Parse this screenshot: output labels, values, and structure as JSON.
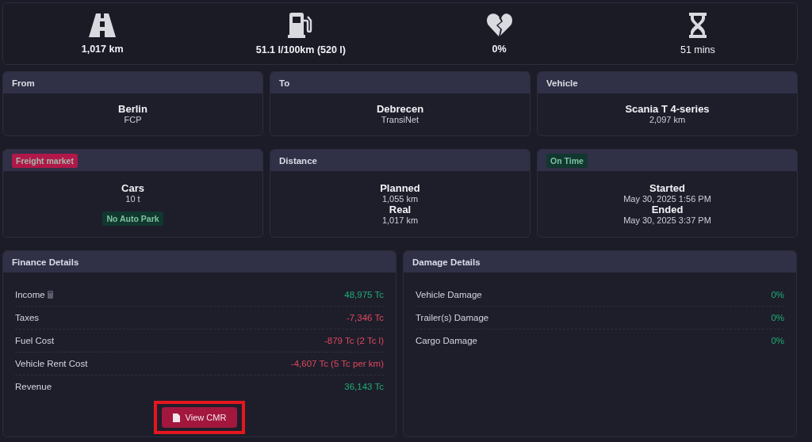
{
  "stats": [
    {
      "kind": "road",
      "value": "1,017 km",
      "emphasis": true
    },
    {
      "kind": "fuel",
      "value": "51.1 l/100km (520 l)",
      "emphasis": true
    },
    {
      "kind": "damage",
      "value": "0%",
      "emphasis": true
    },
    {
      "kind": "time",
      "value": "51 mins",
      "emphasis": false
    }
  ],
  "cards": [
    {
      "header": {
        "kind": "title",
        "text": "From"
      },
      "lines": [
        {
          "kind": "title",
          "text": "Berlin"
        },
        {
          "kind": "sub",
          "text": "FCP"
        }
      ]
    },
    {
      "header": {
        "kind": "title",
        "text": "To"
      },
      "lines": [
        {
          "kind": "title",
          "text": "Debrecen"
        },
        {
          "kind": "sub",
          "text": "TransiNet"
        }
      ]
    },
    {
      "header": {
        "kind": "title",
        "text": "Vehicle"
      },
      "lines": [
        {
          "kind": "title",
          "text": "Scania T 4-series"
        },
        {
          "kind": "sub",
          "text": "2,097 km"
        }
      ]
    },
    {
      "header": {
        "kind": "tag",
        "color": "#b0184a",
        "text": "Freight market"
      },
      "lines": [
        {
          "kind": "title",
          "text": "Cars"
        },
        {
          "kind": "sub",
          "text": "10 t"
        },
        {
          "kind": "tag",
          "color": "#12372f",
          "text": "No Auto Park"
        }
      ]
    },
    {
      "header": {
        "kind": "title",
        "text": "Distance"
      },
      "lines": [
        {
          "kind": "title",
          "text": "Planned"
        },
        {
          "kind": "sub",
          "text": "1,055 km"
        },
        {
          "kind": "title",
          "text": "Real"
        },
        {
          "kind": "sub",
          "text": "1,017 km"
        }
      ]
    },
    {
      "header": {
        "kind": "tag",
        "color": "#12372f",
        "text": "On Time"
      },
      "lines": [
        {
          "kind": "title",
          "text": "Started"
        },
        {
          "kind": "sub",
          "text": "May 30, 2025 1:56 PM"
        },
        {
          "kind": "title",
          "text": "Ended"
        },
        {
          "kind": "sub",
          "text": "May 30, 2025 3:37 PM"
        }
      ]
    }
  ],
  "finance": {
    "title": "Finance Details",
    "rows": [
      {
        "label": "Income",
        "value": "48,975 Tc",
        "color": "#1fae72",
        "info_icon": true
      },
      {
        "label": "Taxes",
        "value": "-7,346 Tc",
        "color": "#e0485e",
        "info_icon": false
      },
      {
        "label": "Fuel Cost",
        "value": "-879 Tc (2 Tc l)",
        "color": "#e0485e",
        "info_icon": false
      },
      {
        "label": "Vehicle Rent Cost",
        "value": "-4,607 Tc (5 Tc per km)",
        "color": "#e0485e",
        "info_icon": false
      },
      {
        "label": "Revenue",
        "value": "36,143 Tc",
        "color": "#1fae72",
        "info_icon": false
      }
    ],
    "button": {
      "label": "View CMR",
      "highlighted": true
    }
  },
  "damage": {
    "title": "Damage Details",
    "rows": [
      {
        "label": "Vehicle Damage",
        "value": "0%",
        "color": "#1fae72"
      },
      {
        "label": "Trailer(s) Damage",
        "value": "0%",
        "color": "#1fae72"
      },
      {
        "label": "Cargo Damage",
        "value": "0%",
        "color": "#1fae72"
      }
    ]
  }
}
